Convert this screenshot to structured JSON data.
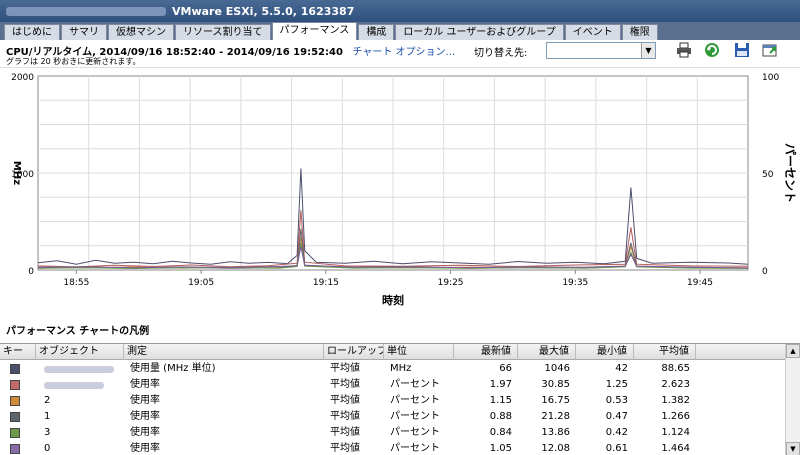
{
  "window": {
    "title": "VMware ESXi, 5.5.0, 1623387"
  },
  "tabs": [
    {
      "label": "はじめに"
    },
    {
      "label": "サマリ"
    },
    {
      "label": "仮想マシン"
    },
    {
      "label": "リソース割り当て"
    },
    {
      "label": "パフォーマンス"
    },
    {
      "label": "構成"
    },
    {
      "label": "ローカル ユーザーおよびグループ"
    },
    {
      "label": "イベント"
    },
    {
      "label": "権限"
    }
  ],
  "toolbar": {
    "title": "CPU/リアルタイム, 2014/09/16 18:52:40 - 2014/09/16 19:52:40",
    "chart_options_link": "チャート オプション...",
    "subtitle": "グラフは 20 秒おきに更新されます。",
    "switch_label": "切り替え先:",
    "switch_value": ""
  },
  "chart_data": {
    "type": "line",
    "xlabel": "時刻",
    "ylabel_left": "MHz",
    "ylabel_right": "パーセント",
    "ylim_left": [
      0,
      2000
    ],
    "ylim_right": [
      0,
      100
    ],
    "yticks_left": [
      "2000",
      "1000",
      "0"
    ],
    "yticks_right": [
      "100",
      "50",
      "0"
    ],
    "x_ticks": [
      "18:55",
      "19:05",
      "19:15",
      "19:25",
      "19:35",
      "19:45"
    ],
    "grid": true,
    "series": [
      {
        "name": "使用量 (MHz 単位)",
        "axis": "left",
        "color": "#4a4f6e",
        "points": [
          [
            0,
            75
          ],
          [
            10,
            95
          ],
          [
            20,
            60
          ],
          [
            30,
            100
          ],
          [
            40,
            70
          ],
          [
            50,
            80
          ],
          [
            60,
            65
          ],
          [
            70,
            90
          ],
          [
            80,
            72
          ],
          [
            90,
            60
          ],
          [
            100,
            85
          ],
          [
            110,
            70
          ],
          [
            120,
            78
          ],
          [
            130,
            66
          ],
          [
            135,
            150
          ],
          [
            137,
            1046
          ],
          [
            139,
            200
          ],
          [
            145,
            80
          ],
          [
            160,
            70
          ],
          [
            175,
            90
          ],
          [
            190,
            65
          ],
          [
            205,
            85
          ],
          [
            220,
            72
          ],
          [
            235,
            60
          ],
          [
            250,
            88
          ],
          [
            265,
            70
          ],
          [
            280,
            80
          ],
          [
            295,
            65
          ],
          [
            306,
            90
          ],
          [
            309,
            850
          ],
          [
            312,
            120
          ],
          [
            320,
            70
          ],
          [
            340,
            80
          ],
          [
            360,
            72
          ],
          [
            370,
            60
          ]
        ]
      },
      {
        "name": "使用率",
        "axis": "right",
        "color": "#b55a5a",
        "points": [
          [
            0,
            2.1
          ],
          [
            20,
            1.6
          ],
          [
            40,
            2.4
          ],
          [
            60,
            1.8
          ],
          [
            80,
            2.6
          ],
          [
            100,
            1.7
          ],
          [
            120,
            2.2
          ],
          [
            135,
            3.5
          ],
          [
            137,
            30.85
          ],
          [
            139,
            4
          ],
          [
            160,
            2.1
          ],
          [
            190,
            1.9
          ],
          [
            220,
            2.4
          ],
          [
            250,
            1.8
          ],
          [
            280,
            2.6
          ],
          [
            306,
            3
          ],
          [
            309,
            22
          ],
          [
            312,
            3
          ],
          [
            340,
            2.1
          ],
          [
            370,
            1.97
          ]
        ]
      },
      {
        "name": "使用率",
        "axis": "right",
        "color": "#c78a3c",
        "points": [
          [
            0,
            1.3
          ],
          [
            25,
            1.1
          ],
          [
            50,
            1.6
          ],
          [
            75,
            1.0
          ],
          [
            100,
            1.4
          ],
          [
            125,
            1.2
          ],
          [
            135,
            2.4
          ],
          [
            137,
            16.75
          ],
          [
            139,
            2.5
          ],
          [
            165,
            1.3
          ],
          [
            195,
            1.1
          ],
          [
            225,
            1.5
          ],
          [
            255,
            1.2
          ],
          [
            285,
            1.4
          ],
          [
            306,
            2
          ],
          [
            309,
            12
          ],
          [
            312,
            2
          ],
          [
            340,
            1.3
          ],
          [
            370,
            1.15
          ]
        ]
      },
      {
        "name": "使用率",
        "axis": "right",
        "color": "#5d646e",
        "points": [
          [
            0,
            1.0
          ],
          [
            25,
            1.3
          ],
          [
            50,
            0.8
          ],
          [
            75,
            1.4
          ],
          [
            100,
            0.9
          ],
          [
            125,
            1.2
          ],
          [
            135,
            2
          ],
          [
            137,
            21.28
          ],
          [
            139,
            2.3
          ],
          [
            165,
            1.1
          ],
          [
            195,
            1.4
          ],
          [
            225,
            0.9
          ],
          [
            255,
            1.2
          ],
          [
            285,
            1.0
          ],
          [
            306,
            1.8
          ],
          [
            309,
            14
          ],
          [
            312,
            1.8
          ],
          [
            340,
            1.1
          ],
          [
            370,
            0.88
          ]
        ]
      },
      {
        "name": "使用率",
        "axis": "right",
        "color": "#6b9a4a",
        "points": [
          [
            0,
            0.9
          ],
          [
            25,
            1.2
          ],
          [
            50,
            0.8
          ],
          [
            75,
            1.1
          ],
          [
            100,
            1.3
          ],
          [
            125,
            0.9
          ],
          [
            135,
            1.8
          ],
          [
            137,
            13.86
          ],
          [
            139,
            2
          ],
          [
            165,
            1.0
          ],
          [
            195,
            1.2
          ],
          [
            225,
            0.9
          ],
          [
            255,
            1.3
          ],
          [
            285,
            1.0
          ],
          [
            306,
            1.6
          ],
          [
            309,
            9
          ],
          [
            312,
            1.6
          ],
          [
            340,
            1.0
          ],
          [
            370,
            0.84
          ]
        ]
      },
      {
        "name": "使用率",
        "axis": "right",
        "color": "#7a5a9a",
        "points": [
          [
            0,
            1.4
          ],
          [
            25,
            1.7
          ],
          [
            50,
            1.2
          ],
          [
            75,
            1.6
          ],
          [
            100,
            1.3
          ],
          [
            125,
            1.8
          ],
          [
            135,
            2.2
          ],
          [
            137,
            12.08
          ],
          [
            139,
            2.4
          ],
          [
            165,
            1.5
          ],
          [
            195,
            1.7
          ],
          [
            225,
            1.2
          ],
          [
            255,
            1.6
          ],
          [
            285,
            1.4
          ],
          [
            306,
            2
          ],
          [
            309,
            8
          ],
          [
            312,
            2
          ],
          [
            340,
            1.5
          ],
          [
            370,
            1.05
          ]
        ]
      }
    ]
  },
  "legend": {
    "title": "パフォーマンス チャートの凡例",
    "columns": [
      "キー",
      "オブジェクト",
      "測定",
      "ロールアップ",
      "単位",
      "最新値",
      "最大値",
      "最小値",
      "平均値"
    ],
    "rows": [
      {
        "color": "#4a4f6e",
        "object": "",
        "measure": "使用量 (MHz 単位)",
        "rollup": "平均値",
        "unit": "MHz",
        "latest": "66",
        "max": "1046",
        "min": "42",
        "avg": "88.65"
      },
      {
        "color": "#c06a6a",
        "object": "",
        "measure": "使用率",
        "rollup": "平均値",
        "unit": "パーセント",
        "latest": "1.97",
        "max": "30.85",
        "min": "1.25",
        "avg": "2.623"
      },
      {
        "color": "#d08a3c",
        "object": "2",
        "measure": "使用率",
        "rollup": "平均値",
        "unit": "パーセント",
        "latest": "1.15",
        "max": "16.75",
        "min": "0.53",
        "avg": "1.382"
      },
      {
        "color": "#5d646e",
        "object": "1",
        "measure": "使用率",
        "rollup": "平均値",
        "unit": "パーセント",
        "latest": "0.88",
        "max": "21.28",
        "min": "0.47",
        "avg": "1.266"
      },
      {
        "color": "#6b9a4a",
        "object": "3",
        "measure": "使用率",
        "rollup": "平均値",
        "unit": "パーセント",
        "latest": "0.84",
        "max": "13.86",
        "min": "0.42",
        "avg": "1.124"
      },
      {
        "color": "#8a6aa8",
        "object": "0",
        "measure": "使用率",
        "rollup": "平均値",
        "unit": "パーセント",
        "latest": "1.05",
        "max": "12.08",
        "min": "0.61",
        "avg": "1.464"
      }
    ]
  },
  "icons": [
    "print-icon",
    "refresh-icon",
    "save-icon",
    "popout-icon"
  ]
}
